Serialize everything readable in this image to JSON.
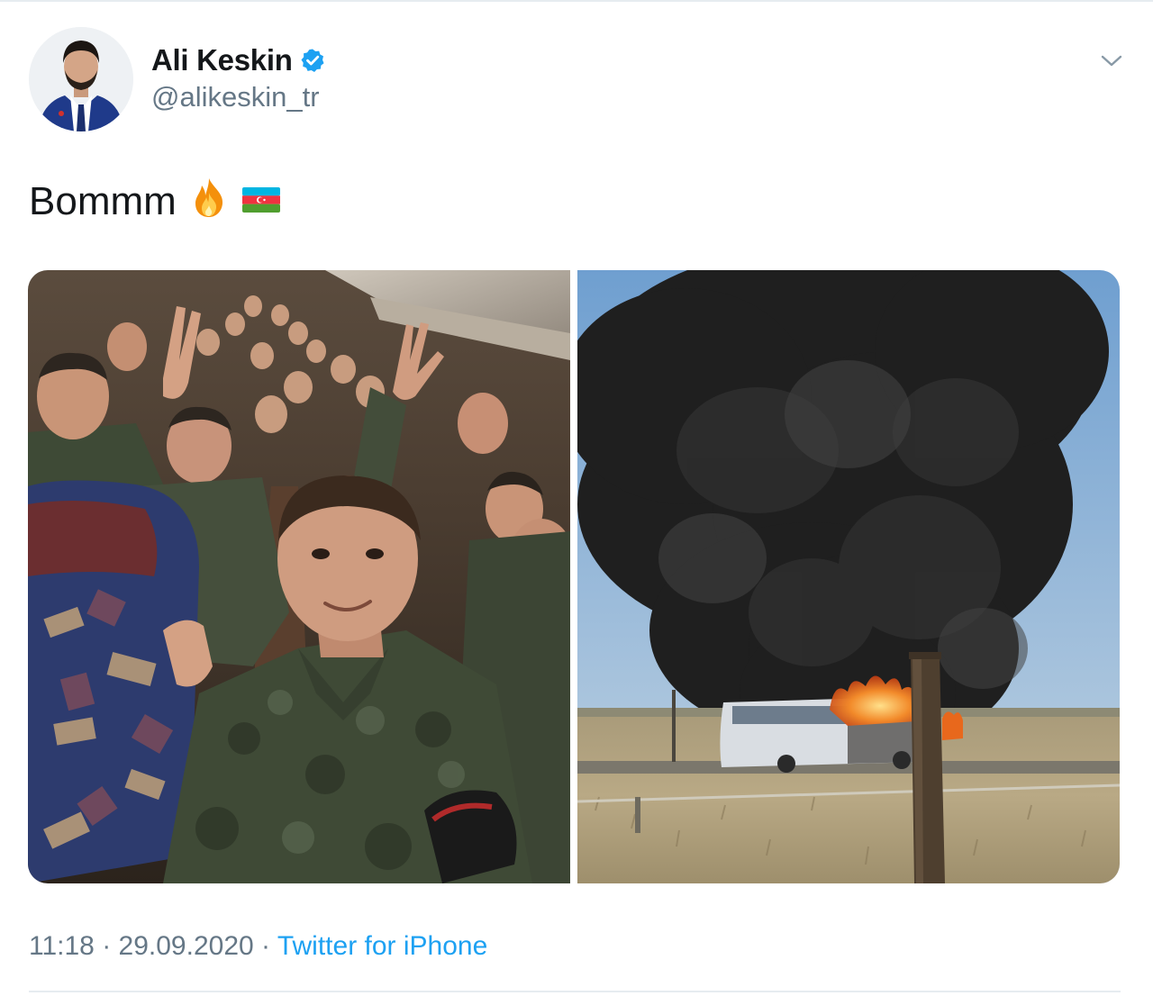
{
  "tweet": {
    "author": {
      "display_name": "Ali Keskin",
      "handle": "@alikeskin_tr",
      "verified": true
    },
    "text": "Bommm",
    "emojis": [
      "fire-icon",
      "azerbaijan-flag-icon"
    ],
    "media": [
      {
        "name": "soldiers-on-bus-selfie",
        "kind": "photo"
      },
      {
        "name": "burning-bus-photo",
        "kind": "photo"
      }
    ],
    "time": "11:18",
    "separator": "·",
    "date": "29.09.2020",
    "source": "Twitter for iPhone"
  },
  "colors": {
    "verified_blue": "#1da1f2",
    "link_blue": "#1da1f2",
    "secondary_text": "#657786",
    "primary_text": "#14171a"
  }
}
